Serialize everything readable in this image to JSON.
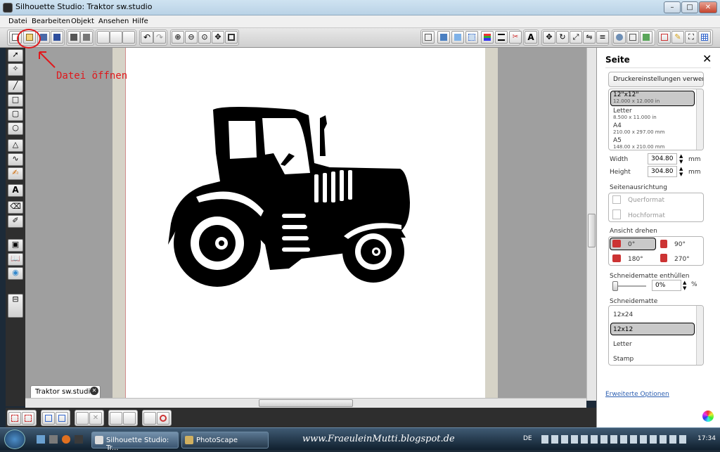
{
  "window": {
    "title": "Silhouette Studio: Traktor sw.studio"
  },
  "menu": [
    "Datei",
    "Bearbeiten",
    "Objekt",
    "Ansehen",
    "Hilfe"
  ],
  "annotation": {
    "text": "Datei öffnen",
    "color": "#e0181c"
  },
  "doc_tab": {
    "label": "Traktor sw.studio",
    "close": "✕"
  },
  "panel": {
    "title": "Seite",
    "close": "✕",
    "printer_button": "Druckereinstellungen verwende",
    "paper_sizes": [
      {
        "name": "12\"x12\"",
        "dims": "12.000 x 12.000 in",
        "selected": true
      },
      {
        "name": "Letter",
        "dims": "8.500 x 11.000 in",
        "selected": false
      },
      {
        "name": "A4",
        "dims": "210.00 x 297.00 mm",
        "selected": false
      },
      {
        "name": "A5",
        "dims": "148.00 x 210.00 mm",
        "selected": false
      }
    ],
    "width_label": "Width",
    "width_value": "304.80",
    "height_label": "Height",
    "height_value": "304.80",
    "unit": "mm",
    "orientation_label": "Seitenausrichtung",
    "landscape": "Querformat",
    "portrait": "Hochformat",
    "rotate_label": "Ansicht drehen",
    "rot0": "0°",
    "rot90": "90°",
    "rot180": "180°",
    "rot270": "270°",
    "reveal_label": "Schneidematte enthüllen",
    "reveal_value": "0%",
    "percent": "%",
    "mat_label": "Schneidematte",
    "mats": [
      {
        "name": "12x24",
        "selected": false
      },
      {
        "name": "12x12",
        "selected": true
      },
      {
        "name": "Letter",
        "selected": false
      },
      {
        "name": "Stamp",
        "selected": false
      }
    ],
    "advanced_link": "Erweiterte Optionen"
  },
  "taskbar": {
    "items": [
      "Silhouette Studio: Tr...",
      "PhotoScape"
    ],
    "watermark": "www.FraeuleinMutti.blogspot.de",
    "lang": "DE",
    "clock": "17:34"
  },
  "window_buttons": {
    "min": "–",
    "max": "□",
    "close": "✕"
  }
}
